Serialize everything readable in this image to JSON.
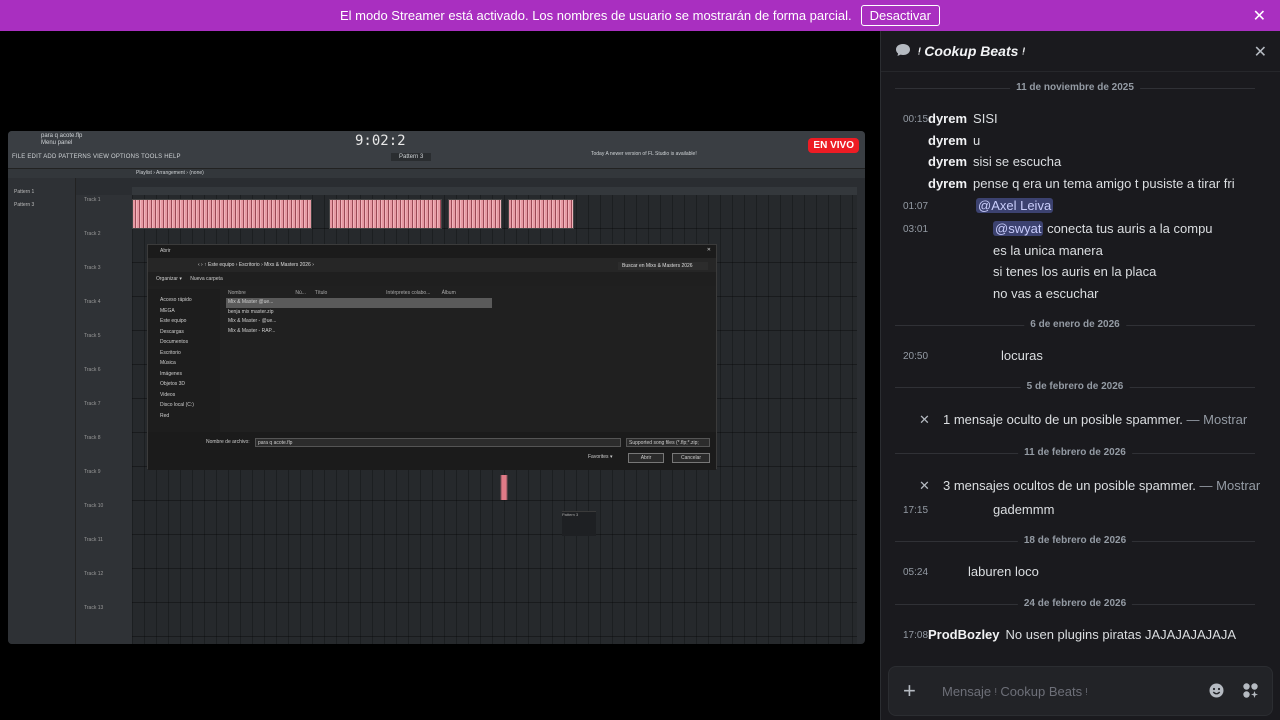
{
  "banner": {
    "text": "El modo Streamer está activado. Los nombres de usuario se mostrarán de forma parcial.",
    "button": "Desactivar",
    "close": "✕"
  },
  "stream": {
    "live_badge": "EN VIVO",
    "fl": {
      "project_file": "para q acote.flp",
      "menu_panel": "Menu panel",
      "menu": "FILE  EDIT  ADD  PATTERNS  VIEW  OPTIONS  TOOLS  HELP",
      "time": "9:02:2",
      "pattern": "Pattern 3",
      "news": "Today  A newer version of FL Studio is available!",
      "playlist_bar": "Playlist › Arrangement › (none)",
      "pattern_list": [
        "Pattern 1",
        "Pattern 3"
      ],
      "tracks": [
        "Track 1",
        "Track 2",
        "Track 3",
        "Track 4",
        "Track 5",
        "Track 6",
        "Track 7",
        "Track 8",
        "Track 9",
        "Track 10",
        "Track 11",
        "Track 12",
        "Track 13"
      ],
      "pattern_block": "Pattern 3",
      "dialog": {
        "title": "Abrir",
        "path": "‹  ›  ↑  Este equipo › Escritorio › Mixs & Masters 2026 ›",
        "search": "Buscar en Mixs & Masters 2026",
        "organize": "Organizar ▾",
        "new_folder": "Nueva carpeta",
        "sidebar": [
          "Acceso rápido",
          "MEGA",
          "Este equipo",
          "Descargas",
          "Documentos",
          "Escritorio",
          "Música",
          "Imágenes",
          "Objetos 3D",
          "Videos",
          "Disco local (C:)",
          "Red"
        ],
        "columns": [
          "Nombre",
          "Nú...",
          "Título",
          "Intérpretes colabo...",
          "Álbum"
        ],
        "files": [
          "Mix & Master @ue...",
          "benja mix master.zip",
          "Mix & Master - @ue...",
          "Mix & Master - RAP..."
        ],
        "filename_label": "Nombre de archivo:",
        "filename": "para q acote.flp",
        "filter": "Supported song files (*.flp;*.zip;",
        "favorites": "Favorites ▾",
        "open": "Abrir",
        "cancel": "Cancelar"
      }
    }
  },
  "chat": {
    "title": "ᵎ Cookup Beats ᵎ",
    "close": "✕",
    "items": [
      {
        "type": "divider",
        "text": "11 de noviembre de 2025"
      },
      {
        "type": "msg",
        "time": "00:15",
        "user": "dyrem",
        "text": "SISI"
      },
      {
        "type": "msg",
        "user": "dyrem",
        "text": "u"
      },
      {
        "type": "msg",
        "user": "dyrem",
        "text": "sisi se escucha"
      },
      {
        "type": "msg",
        "user": "dyrem",
        "text": "pense q era un tema amigo t pusiste a tirar fri"
      },
      {
        "type": "mention",
        "time": "01:07",
        "text": "@Axel Leiva"
      },
      {
        "type": "msg",
        "time": "03:01",
        "mention": "@swyat",
        "text": "conecta tus auris a la compu"
      },
      {
        "type": "msg",
        "text": "es la unica manera"
      },
      {
        "type": "msg",
        "text": "si tenes los auris en la placa"
      },
      {
        "type": "msg",
        "text": "no vas a escuchar"
      },
      {
        "type": "divider",
        "text": "6 de enero de 2026"
      },
      {
        "type": "msg",
        "time": "20:50",
        "text": "locuras"
      },
      {
        "type": "divider",
        "text": "5 de febrero de 2026"
      },
      {
        "type": "hidden",
        "text": "1 mensaje oculto de un posible spammer.",
        "link": "— Mostrar"
      },
      {
        "type": "divider",
        "text": "11 de febrero de 2026"
      },
      {
        "type": "hidden",
        "text": "3 mensajes ocultos de un posible spammer.",
        "link": "— Mostrar"
      },
      {
        "type": "msg",
        "time": "17:15",
        "text": "gademmm"
      },
      {
        "type": "divider",
        "text": "18 de febrero de 2026"
      },
      {
        "type": "msg",
        "time": "05:24",
        "text": "laburen loco"
      },
      {
        "type": "divider",
        "text": "24 de febrero de 2026"
      },
      {
        "type": "msg",
        "time": "17:08",
        "user": "ProdBozley",
        "text": "No usen plugins piratas JAJAJAJAJAJA"
      }
    ],
    "composer_placeholder": "Mensaje ᵎ Cookup Beats ᵎ",
    "composer_plus": "+"
  }
}
